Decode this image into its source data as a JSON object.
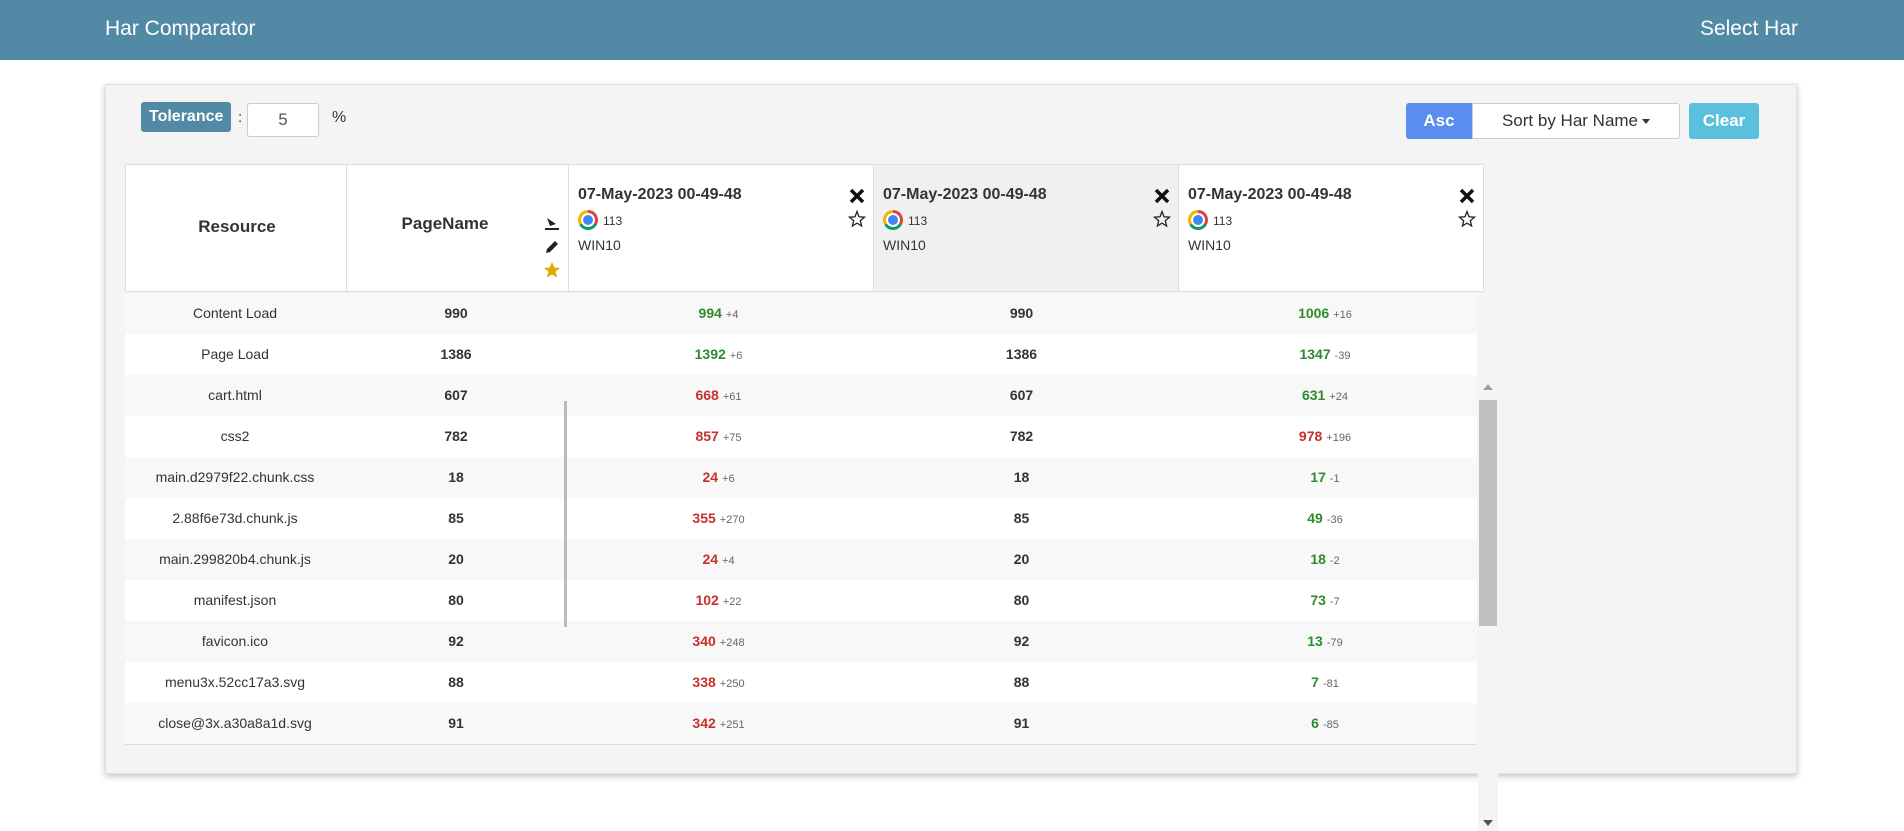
{
  "navbar": {
    "brand": "Har Comparator",
    "select_har": "Select Har",
    "color": "#528aa6"
  },
  "toolbar": {
    "tolerance_label": "Tolerance",
    "colon": ":",
    "tolerance_value": "5",
    "percent": "%",
    "asc_label": "Asc",
    "sort_label": "Sort by Har Name",
    "clear_label": "Clear"
  },
  "table": {
    "headers": {
      "resource": "Resource",
      "page_name": "PageName"
    },
    "hars": [
      {
        "date": "07-May-2023 00-49-48",
        "browser_icon": "chrome-icon",
        "version": "113",
        "os": "WIN10"
      },
      {
        "date": "07-May-2023 00-49-48",
        "browser_icon": "chrome-icon",
        "version": "113",
        "os": "WIN10"
      },
      {
        "date": "07-May-2023 00-49-48",
        "browser_icon": "chrome-icon",
        "version": "113",
        "os": "WIN10"
      }
    ],
    "rows": [
      {
        "resource": "Content Load",
        "page": "990",
        "h1": "994",
        "d1": "+4",
        "c1": "green",
        "h2": "990",
        "h3": "1006",
        "d3": "+16",
        "c3": "green"
      },
      {
        "resource": "Page Load",
        "page": "1386",
        "h1": "1392",
        "d1": "+6",
        "c1": "green",
        "h2": "1386",
        "h3": "1347",
        "d3": "-39",
        "c3": "green"
      },
      {
        "resource": "cart.html",
        "page": "607",
        "h1": "668",
        "d1": "+61",
        "c1": "red",
        "h2": "607",
        "h3": "631",
        "d3": "+24",
        "c3": "green"
      },
      {
        "resource": "css2",
        "page": "782",
        "h1": "857",
        "d1": "+75",
        "c1": "red",
        "h2": "782",
        "h3": "978",
        "d3": "+196",
        "c3": "red"
      },
      {
        "resource": "main.d2979f22.chunk.css",
        "page": "18",
        "h1": "24",
        "d1": "+6",
        "c1": "red",
        "h2": "18",
        "h3": "17",
        "d3": "-1",
        "c3": "green"
      },
      {
        "resource": "2.88f6e73d.chunk.js",
        "page": "85",
        "h1": "355",
        "d1": "+270",
        "c1": "red",
        "h2": "85",
        "h3": "49",
        "d3": "-36",
        "c3": "green"
      },
      {
        "resource": "main.299820b4.chunk.js",
        "page": "20",
        "h1": "24",
        "d1": "+4",
        "c1": "red",
        "h2": "20",
        "h3": "18",
        "d3": "-2",
        "c3": "green"
      },
      {
        "resource": "manifest.json",
        "page": "80",
        "h1": "102",
        "d1": "+22",
        "c1": "red",
        "h2": "80",
        "h3": "73",
        "d3": "-7",
        "c3": "green"
      },
      {
        "resource": "favicon.ico",
        "page": "92",
        "h1": "340",
        "d1": "+248",
        "c1": "red",
        "h2": "92",
        "h3": "13",
        "d3": "-79",
        "c3": "green"
      },
      {
        "resource": "menu3x.52cc17a3.svg",
        "page": "88",
        "h1": "338",
        "d1": "+250",
        "c1": "red",
        "h2": "88",
        "h3": "7",
        "d3": "-81",
        "c3": "green"
      },
      {
        "resource": "close@3x.a30a8a1d.svg",
        "page": "91",
        "h1": "342",
        "d1": "+251",
        "c1": "red",
        "h2": "91",
        "h3": "6",
        "d3": "-85",
        "c3": "green"
      }
    ]
  }
}
